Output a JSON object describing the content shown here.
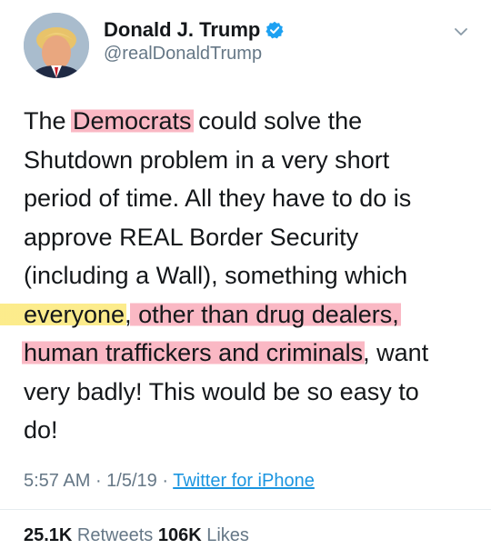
{
  "author": {
    "display_name": "Donald J. Trump",
    "handle": "@realDonaldTrump",
    "verified": true,
    "icons": [
      "avatar",
      "verified-icon",
      "chevron-down-icon"
    ]
  },
  "tweet": {
    "lines": [
      [
        "The ",
        "Democrats",
        " could solve the"
      ],
      [
        "Shutdown problem in a very short"
      ],
      [
        "period of time. All they have to do is"
      ],
      [
        "approve REAL Border Security"
      ],
      [
        "(including a Wall), something which"
      ],
      [
        "everyone",
        ",",
        " other than drug dealers,"
      ],
      [
        "human traffickers and criminals",
        ", want"
      ],
      [
        "very badly! This would be so easy to"
      ],
      [
        "do!"
      ]
    ]
  },
  "meta": {
    "time": "5:57 AM",
    "sep1": " · ",
    "date": "1/5/19",
    "sep2": " · ",
    "source": "Twitter for iPhone"
  },
  "stats": {
    "retweets_count": "25.1K",
    "retweets_label": " Retweets ",
    "likes_count": "106K",
    "likes_label": " Likes"
  },
  "colors": {
    "text": "#14171a",
    "secondary": "#657786",
    "link": "#1b95e0",
    "highlight_pink": "#f8a0b0",
    "highlight_yellow": "#fce878",
    "verified": "#1da1f2"
  }
}
